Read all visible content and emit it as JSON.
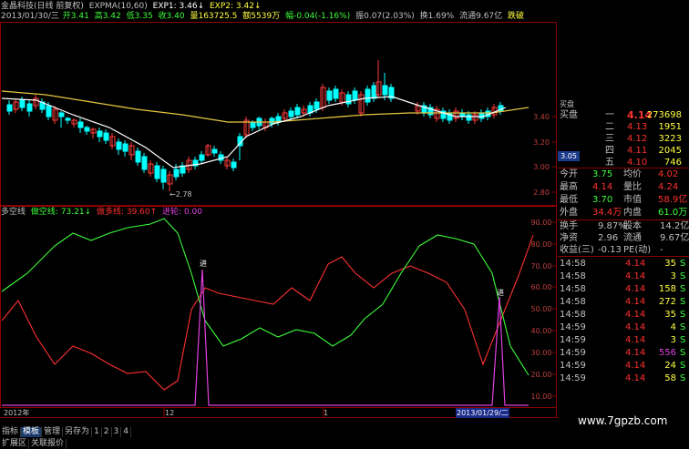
{
  "header": {
    "stock_title": "金晶科技(日线 前复权)",
    "ema_label": "EXPMA(10,60)",
    "exp1": "EXP1: 3.46↓",
    "exp2": "EXP2: 3.42↓",
    "date": "2013/01/30/三",
    "open": "开3.41",
    "high": "高3.42",
    "low": "低3.35",
    "close": "收3.40",
    "volume": "量163725.5",
    "amount": "额5539万",
    "change": "幅-0.04(-1.16%)",
    "amplitude": "振0.07(2.03%)",
    "turnover": "换1.69%",
    "float": "流通9.67亿",
    "tag": "跌破"
  },
  "price_axis": {
    "ticks": [
      "3.40",
      "3.20",
      "3.00",
      "2.80"
    ],
    "current": "3.05"
  },
  "low_marker": "2.78",
  "indicator": {
    "name": "多空线",
    "line1": "做空线: 73.21↓",
    "line2": "做多线: 39.60↑",
    "line3": "进轮: 0.00",
    "axis": [
      "90.00",
      "80.00",
      "70.00",
      "60.00",
      "50.00",
      "40.00",
      "30.00",
      "20.00",
      "10.00"
    ],
    "marker": "进"
  },
  "time_axis": {
    "labels": [
      "2012年",
      "12",
      "1"
    ],
    "current": "2013/01/29/二"
  },
  "tabs": [
    "指标",
    "模板",
    "管理",
    "另存为",
    "1",
    "2",
    "3",
    "4"
  ],
  "bottom_tabs": [
    "扩展区",
    "关联报价"
  ],
  "watermark": "www.7gpzb.com",
  "quote": {
    "title": "买盘",
    "asks": [
      {
        "label": "一",
        "price": "4.14",
        "vol": "273698"
      },
      {
        "label": "二",
        "price": "4.13",
        "vol": "1951"
      },
      {
        "label": "三",
        "price": "4.12",
        "vol": "3223"
      },
      {
        "label": "四",
        "price": "4.11",
        "vol": "2045"
      },
      {
        "label": "五",
        "price": "4.10",
        "vol": "746"
      }
    ],
    "ask_prefix": "买盘",
    "stats": [
      {
        "l1": "今开",
        "v1": "3.75",
        "l2": "均价",
        "v2": "4.02"
      },
      {
        "l1": "最高",
        "v1": "4.14",
        "l2": "量比",
        "v2": "4.24"
      },
      {
        "l1": "最低",
        "v1": "3.70",
        "l2": "市值",
        "v2": "58.9亿"
      },
      {
        "l1": "外盘",
        "v1": "34.4万",
        "l2": "内盘",
        "v2": "61.0万"
      }
    ],
    "stats2": [
      {
        "l1": "换手",
        "v1": "9.87%",
        "l2": "股本",
        "v2": "14.2亿"
      },
      {
        "l1": "净资",
        "v1": "2.96",
        "l2": "流通",
        "v2": "9.67亿"
      },
      {
        "l1": "收益(三)",
        "v1": "-0.13",
        "l2": "PE(动)",
        "v2": "-"
      }
    ],
    "ticks": [
      {
        "t": "14:58",
        "p": "4.14",
        "v": "35",
        "s": "S"
      },
      {
        "t": "14:58",
        "p": "4.14",
        "v": "3",
        "s": "S"
      },
      {
        "t": "14:58",
        "p": "4.14",
        "v": "158",
        "s": "S"
      },
      {
        "t": "14:58",
        "p": "4.14",
        "v": "272",
        "s": "S"
      },
      {
        "t": "14:58",
        "p": "4.14",
        "v": "35",
        "s": "S"
      },
      {
        "t": "14:59",
        "p": "4.14",
        "v": "4",
        "s": "S"
      },
      {
        "t": "14:59",
        "p": "4.14",
        "v": "3",
        "s": "S"
      },
      {
        "t": "14:59",
        "p": "4.14",
        "v": "556",
        "s": "S"
      },
      {
        "t": "14:59",
        "p": "4.14",
        "v": "24",
        "s": "S"
      },
      {
        "t": "14:59",
        "p": "4.14",
        "v": "58",
        "s": "S"
      }
    ]
  },
  "colors": {
    "up": "#ff3c3c",
    "down": "#00ffff",
    "ema1": "#ffffff",
    "ema2": "#e5c540",
    "green": "#3cff3c",
    "red": "#ff3030",
    "purple": "#e040e0",
    "yellow": "#ffff40"
  }
}
